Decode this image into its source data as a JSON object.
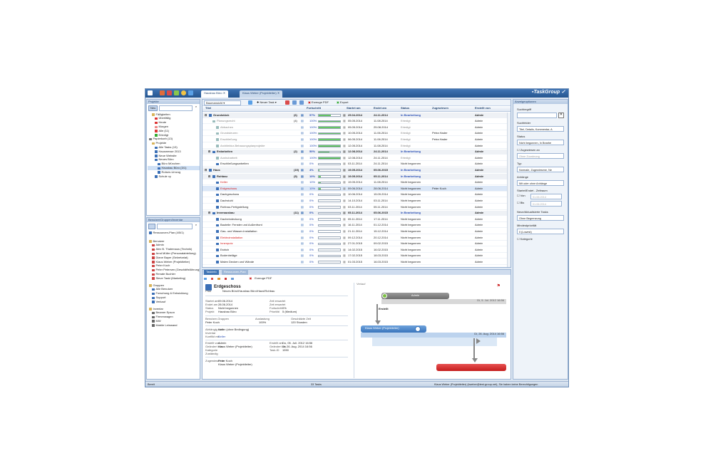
{
  "app": {
    "logo": "TaskGroup"
  },
  "tabs": [
    {
      "label": "Hausbau Büro"
    },
    {
      "label": "Klaus Weber (Projektleiter)"
    }
  ],
  "projects": {
    "header": "Projekte",
    "search_btn": "Neu",
    "tree": [
      {
        "label": "Fälligkeiten",
        "icon": "folder-icon",
        "color": "#d8b45a",
        "indent": 1
      },
      {
        "label": "Überfällig",
        "icon": "flag-icon",
        "color": "#d33",
        "indent": 2
      },
      {
        "label": "Heute",
        "icon": "flag-icon",
        "color": "#d33",
        "indent": 2
      },
      {
        "label": "Morgen",
        "icon": "flag-icon",
        "color": "#e88",
        "indent": 2
      },
      {
        "label": "Alle (11)",
        "icon": "flag-icon",
        "color": "#d33",
        "indent": 2
      },
      {
        "label": "Erledigt",
        "icon": "check-icon",
        "color": "#3a3",
        "indent": 2
      },
      {
        "label": "Papierkorb (13)",
        "icon": "trash-icon",
        "color": "#777",
        "indent": 0
      },
      {
        "label": "Projekte",
        "icon": "folder-icon",
        "color": "#d8b45a",
        "indent": 1
      },
      {
        "label": "Alle Tasks (13)",
        "icon": "list-icon",
        "color": "#3b6fb6",
        "indent": 2
      },
      {
        "label": "Hausmesse 2013",
        "icon": "project-icon",
        "color": "#3b6fb6",
        "indent": 2
      },
      {
        "label": "Neue Website",
        "icon": "project-icon",
        "color": "#3b6fb6",
        "indent": 2
      },
      {
        "label": "Neues Büro",
        "icon": "project-icon",
        "color": "#3b6fb6",
        "indent": 2
      },
      {
        "label": "Büro München",
        "icon": "project-icon",
        "color": "#3b6fb6",
        "indent": 3
      },
      {
        "label": "Hausbau Büro (3/1)",
        "icon": "project-icon",
        "color": "#3b6fb6",
        "indent": 3,
        "sel": true
      },
      {
        "label": "Rotsen-Umzug",
        "icon": "project-icon",
        "color": "#3b6fb6",
        "indent": 3
      },
      {
        "label": "Schule xy",
        "icon": "project-icon",
        "color": "#3b6fb6",
        "indent": 2
      }
    ]
  },
  "users": {
    "header": "Benutzer/Gruppen/Inventar",
    "plan": "Ressourcen-Plan (4/5/1)",
    "sections": [
      {
        "title": "Benutzer",
        "items": [
          "Admin",
          "Alex B. Thalemaus (Technik)",
          "Arnd Müller (Personalabteilung)",
          "Diane Bayer (Sekretariat)",
          "Klaus Weber (Projektleiter)",
          "Peter Koch",
          "Peter Petersen (Geschäftsführung)",
          "Renate Buchler",
          "Steve Taski (Marketing)"
        ]
      },
      {
        "title": "Gruppen",
        "items": [
          "Alle Benutzer",
          "Forschung & Entwicklung",
          "Support",
          "Verkauf"
        ]
      },
      {
        "title": "Inventar",
        "items": [
          "Beamer Epson",
          "Firmenwagen",
          "MW",
          "Mobile Leinwand"
        ]
      }
    ]
  },
  "grid": {
    "toolbar": {
      "view": "Baumansicht",
      "new_task": "Neuer Task",
      "pdf": "Erzeuge PDF",
      "export": "Export"
    },
    "headers": {
      "title": "Titel",
      "progress": "Fortschritt",
      "start": "Startet am",
      "end": "Endet am",
      "status": "Status",
      "assigned": "Zugewiesen",
      "created": "Erstellt von"
    },
    "rows": [
      {
        "indent": 0,
        "title": "Grundstück",
        "count": "(6)",
        "pct": "57%",
        "p": 57,
        "start": "25.04.2014",
        "end": "24.11.2014",
        "status": "In Bearbeitung",
        "assigned": "",
        "created": "Admin",
        "grp": true
      },
      {
        "indent": 1,
        "title": "Planungsrecht",
        "count": "(4)",
        "pct": "100%",
        "p": 100,
        "start": "05.05.2014",
        "end": "11.08.2014",
        "status": "Erledigt",
        "assigned": "",
        "created": "Admin",
        "done": true
      },
      {
        "indent": 2,
        "title": "Abbachen",
        "count": "",
        "pct": "100%",
        "p": 100,
        "start": "05.05.2014",
        "end": "25.08.2014",
        "status": "Erledigt",
        "assigned": "",
        "created": "Admin",
        "done": true
      },
      {
        "indent": 2,
        "title": "Grundsteuren",
        "count": "",
        "pct": "100%",
        "p": 100,
        "start": "10.05.2014",
        "end": "11.06.2014",
        "status": "Erledigt",
        "assigned": "Petra Hader",
        "created": "Admin",
        "done": true
      },
      {
        "indent": 2,
        "title": "Erschließung",
        "count": "",
        "pct": "100%",
        "p": 100,
        "start": "06.05.2014",
        "end": "11.06.2014",
        "status": "Erledigt",
        "assigned": "Petra Hader",
        "created": "Admin",
        "done": true
      },
      {
        "indent": 2,
        "title": "Architektur-Bebauungsplanprojekte",
        "count": "",
        "pct": "100%",
        "p": 100,
        "start": "12.05.2014",
        "end": "11.08.2014",
        "status": "Erledigt",
        "assigned": "",
        "created": "Admin",
        "done": true
      },
      {
        "indent": 1,
        "title": "Erdarbeiten",
        "count": "(2)",
        "pct": "50%",
        "p": 50,
        "start": "12.08.2014",
        "end": "24.11.2014",
        "status": "In Bearbeitung",
        "assigned": "",
        "created": "Admin",
        "grp": true
      },
      {
        "indent": 2,
        "title": "Aushubarbeit",
        "count": "",
        "pct": "100%",
        "p": 100,
        "start": "12.08.2014",
        "end": "24.11.2014",
        "status": "Erledigt",
        "assigned": "",
        "created": "Admin",
        "done": true
      },
      {
        "indent": 2,
        "title": "Erschließungsarbeiten",
        "count": "",
        "pct": "0%",
        "p": 0,
        "start": "03.11.2014",
        "end": "24.11.2014",
        "status": "Nicht begonnen",
        "assigned": "",
        "created": "Admin"
      },
      {
        "indent": 0,
        "title": "Haus",
        "count": "(15)",
        "pct": "4%",
        "p": 4,
        "start": "19.05.2014",
        "end": "05.06.2015",
        "status": "In Bearbeitung",
        "assigned": "",
        "created": "Admin",
        "grp": true
      },
      {
        "indent": 1,
        "title": "Rohbau",
        "count": "(5)",
        "pct": "10%",
        "p": 10,
        "start": "19.05.2014",
        "end": "05.11.2014",
        "status": "In Bearbeitung",
        "assigned": "",
        "created": "Admin",
        "grp": true
      },
      {
        "indent": 2,
        "title": "Keller",
        "count": "",
        "pct": "10%",
        "p": 10,
        "start": "19.05.2014",
        "end": "11.08.2014",
        "status": "Nicht begonnen",
        "assigned": "",
        "created": "Admin",
        "red": true
      },
      {
        "indent": 2,
        "title": "Erdgeschoss",
        "count": "",
        "pct": "10%",
        "p": 10,
        "start": "09.06.2014",
        "end": "28.06.2014",
        "status": "Nicht begonnen",
        "assigned": "Peter Koch",
        "created": "Admin",
        "red": true,
        "sel": true
      },
      {
        "indent": 2,
        "title": "Dachgeschoss",
        "count": "",
        "pct": "0%",
        "p": 0,
        "start": "10.06.2014",
        "end": "15.09.2014",
        "status": "Nicht begonnen",
        "assigned": "",
        "created": "Admin"
      },
      {
        "indent": 2,
        "title": "Dachstuhl",
        "count": "",
        "pct": "0%",
        "p": 0,
        "start": "14.10.2014",
        "end": "03.11.2014",
        "status": "Nicht begonnen",
        "assigned": "",
        "created": "Admin"
      },
      {
        "indent": 2,
        "title": "Rohbau-Fertigstellung",
        "count": "",
        "pct": "0%",
        "p": 0,
        "start": "03.11.2014",
        "end": "05.11.2014",
        "status": "Nicht begonnen",
        "assigned": "",
        "created": "Admin"
      },
      {
        "indent": 1,
        "title": "Innenausbau",
        "count": "(11)",
        "pct": "0%",
        "p": 0,
        "start": "05.11.2014",
        "end": "05.06.2015",
        "status": "In Bearbeitung",
        "assigned": "",
        "created": "Admin",
        "grp": true
      },
      {
        "indent": 2,
        "title": "Dacheindeckung",
        "count": "",
        "pct": "0%",
        "p": 0,
        "start": "05.11.2014",
        "end": "17.11.2014",
        "status": "Nicht begonnen",
        "assigned": "",
        "created": "Admin"
      },
      {
        "indent": 2,
        "title": "Bauteile: Fenster und Außenfront",
        "count": "",
        "pct": "0%",
        "p": 0,
        "start": "16.11.2014",
        "end": "01.12.2014",
        "status": "Nicht begonnen",
        "assigned": "",
        "created": "Admin"
      },
      {
        "indent": 2,
        "title": "Gas- und Wasser-Installation",
        "count": "",
        "pct": "0%",
        "p": 0,
        "start": "21.11.2014",
        "end": "15.12.2014",
        "status": "Nicht begonnen",
        "assigned": "",
        "created": "Admin"
      },
      {
        "indent": 2,
        "title": "Elektroinstallation",
        "count": "",
        "pct": "0%",
        "p": 0,
        "start": "09.12.2014",
        "end": "20.12.2014",
        "status": "Nicht begonnen",
        "assigned": "",
        "created": "Admin",
        "red": true
      },
      {
        "indent": 2,
        "title": "Innenputz",
        "count": "",
        "pct": "0%",
        "p": 0,
        "start": "27.01.2015",
        "end": "09.02.2015",
        "status": "Nicht begonnen",
        "assigned": "",
        "created": "Admin",
        "red": true
      },
      {
        "indent": 2,
        "title": "Estrich",
        "count": "",
        "pct": "0%",
        "p": 0,
        "start": "14.02.2015",
        "end": "16.02.2015",
        "status": "Nicht begonnen",
        "assigned": "",
        "created": "Admin"
      },
      {
        "indent": 2,
        "title": "Bodenbeläge",
        "count": "",
        "pct": "0%",
        "p": 0,
        "start": "17.02.2015",
        "end": "18.03.2015",
        "status": "Nicht begonnen",
        "assigned": "",
        "created": "Admin"
      },
      {
        "indent": 2,
        "title": "Malen Decken und Wände",
        "count": "",
        "pct": "0%",
        "p": 0,
        "start": "01.03.2015",
        "end": "16.03.2015",
        "status": "Nicht begonnen",
        "assigned": "",
        "created": "Admin"
      }
    ]
  },
  "filter": {
    "header": "Anzeigeoptionen",
    "search_label": "Suchbegriff",
    "search_field_label": "Suchfelder",
    "search_field_value": "Titel, Details, Kommentar, A",
    "status_label": "Status",
    "status_value": "Nicht begonnen, In Bearbe",
    "assigned_label": "Zugewiesen an",
    "assigned_value": "Ohne Zuordnung",
    "type_label": "Typ",
    "type_value": "Normale, Zugewiesene, Ne",
    "attach_label": "Anhänge",
    "attach_value": "Mit oder ohne Anhänge",
    "dates_label": "Startet/Endet - Zeitraum",
    "von": "Von",
    "bis": "Bis",
    "date_ph": "01.06.2014",
    "recent_label": "Neue/Aktualisierte Tasks",
    "recent_value": "Ohne Begrenzung",
    "priority_label": "Mindestpriorität",
    "priority_value": "0 (Lowest)",
    "category_label": "Kategorie"
  },
  "detail": {
    "tabs": [
      "Taskinfo",
      "Ressourcen-Plan"
    ],
    "pdf": "Erzeuge PDF",
    "title": "Erdgeschoss",
    "path_label": "Pfad",
    "path_value": "Neues Büro\\Hausbau Büro\\Haus\\Rohbau",
    "fields": [
      [
        "Startet am",
        "09.06.2014",
        "Zeit erwartet",
        ""
      ],
      [
        "Endet am",
        "28.06.2014",
        "Zeit erwartet",
        ""
      ],
      [
        "Status",
        "Nicht begonnen",
        "Fortschritt",
        "0%"
      ],
      [
        "Projekt",
        "Hausbau Büro",
        "Priorität",
        "5 (Medium)"
      ]
    ],
    "group_label": "Benutzer-Gruppen",
    "group_value": "Peter Koch",
    "util_label": "Auslastung",
    "util_value": "100%",
    "budget_label": "Geschätzte Zeit",
    "budget_value": "120 Stunden",
    "dep_label": "Abhängig vom",
    "dep_value": "Keller (ohne Bedingung)",
    "inv_label": "Inventar",
    "inv_value": "",
    "conf_label": "Konflikt mit",
    "conf_value": "Keller",
    "created_label": "Erstellt von",
    "created_value": "Admin",
    "created_at_label": "Erstellt am",
    "created_at_value": "Do, 05. Juli. 2012 16:56",
    "changed_label": "Geändert von",
    "changed_value": "Klaus Weber (Projektleiter)",
    "changed_at_label": "Geändert am",
    "changed_at_value": "Di, 26. Aug. 2014 16:56",
    "cat_label": "Kategorie",
    "task_label": "Task-ID",
    "task_value": "1590",
    "close_label": "Zuständig",
    "assigned_label": "Zugewiesen an",
    "assigned_value": "Peter Koch",
    "assigned2_value": "Klaus Weber (Projektleiter)"
  },
  "flow": {
    "label": "Verlauf",
    "node1": "Admin",
    "node1_date": "Di, 5. Jul. 2012 16:56",
    "step1": "Erstellt",
    "node2": "Klaus Weber (Projektleiter)",
    "node2_date": "Di, 26. Aug. 2014 16:56"
  },
  "status": {
    "ready": "Bereit",
    "count": "33 Tasks",
    "right": "Klaus Weber (Projektleiter) (kweber@test-group.net), Sie haben keine Berechtigungen"
  }
}
